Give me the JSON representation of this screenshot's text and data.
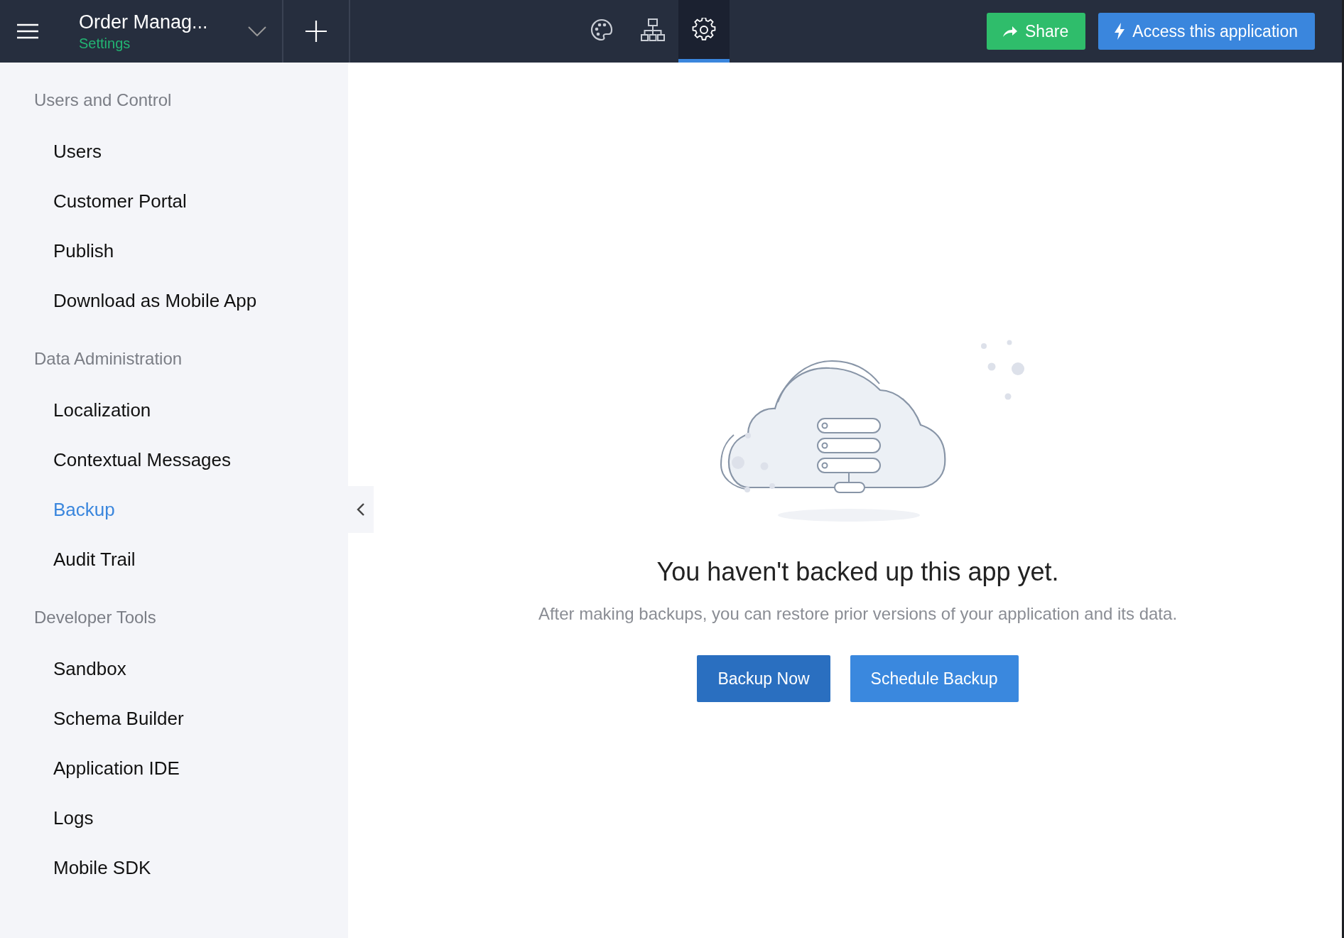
{
  "header": {
    "app_title": "Order Manag...",
    "subtitle": "Settings",
    "tools": [
      {
        "kind": "palette",
        "selected": false
      },
      {
        "kind": "hierarchy",
        "selected": false
      },
      {
        "kind": "gear",
        "selected": true
      }
    ],
    "buttons": [
      {
        "kind": "share",
        "label": "Share"
      },
      {
        "kind": "access",
        "label": "Access this application"
      }
    ]
  },
  "sidebar": {
    "sections": [
      {
        "title": "Users and Control",
        "items": [
          {
            "label": "Users",
            "selected": false
          },
          {
            "label": "Customer Portal",
            "selected": false
          },
          {
            "label": "Publish",
            "selected": false
          },
          {
            "label": "Download as Mobile App",
            "selected": false
          }
        ]
      },
      {
        "title": "Data Administration",
        "items": [
          {
            "label": "Localization",
            "selected": false
          },
          {
            "label": "Contextual Messages",
            "selected": false
          },
          {
            "label": "Backup",
            "selected": true
          },
          {
            "label": "Audit Trail",
            "selected": false
          }
        ]
      },
      {
        "title": "Developer Tools",
        "items": [
          {
            "label": "Sandbox",
            "selected": false
          },
          {
            "label": "Schema Builder",
            "selected": false
          },
          {
            "label": "Application IDE",
            "selected": false
          },
          {
            "label": "Logs",
            "selected": false
          },
          {
            "label": "Mobile SDK",
            "selected": false
          }
        ]
      }
    ]
  },
  "empty_state": {
    "heading": "You haven't backed up this app yet.",
    "description": "After making backups, you can restore prior versions of your application and its data.",
    "buttons": [
      {
        "kind": "primary",
        "label": "Backup Now"
      },
      {
        "kind": "secondary",
        "label": "Schedule Backup"
      }
    ]
  }
}
